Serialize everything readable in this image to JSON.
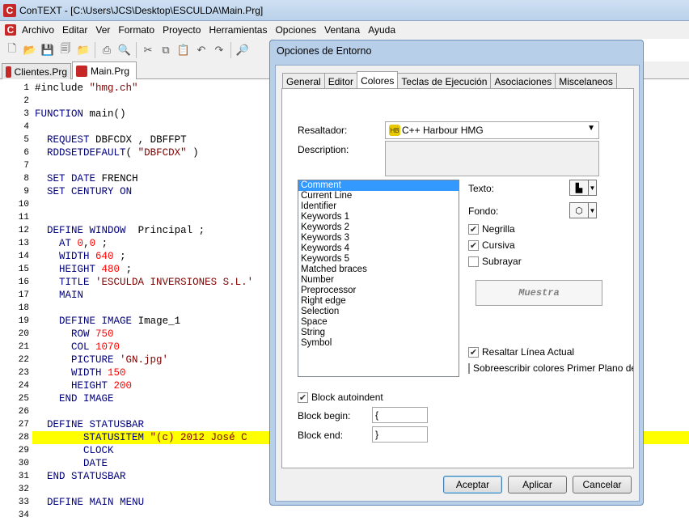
{
  "window": {
    "title": "ConTEXT - [C:\\Users\\JCS\\Desktop\\ESCULDA\\Main.Prg]"
  },
  "menu": [
    "Archivo",
    "Editar",
    "Ver",
    "Formato",
    "Proyecto",
    "Herramientas",
    "Opciones",
    "Ventana",
    "Ayuda"
  ],
  "file_tabs": [
    "Clientes.Prg",
    "Main.Prg"
  ],
  "editor": {
    "lines": [
      {
        "n": "1",
        "code": "#include \"hmg.ch\""
      },
      {
        "n": "2",
        "code": ""
      },
      {
        "n": "3",
        "code": "FUNCTION main()"
      },
      {
        "n": "4",
        "code": ""
      },
      {
        "n": "5",
        "code": "  REQUEST DBFCDX , DBFFPT"
      },
      {
        "n": "6",
        "code": "  RDDSETDEFAULT( \"DBFCDX\" )"
      },
      {
        "n": "7",
        "code": ""
      },
      {
        "n": "8",
        "code": "  SET DATE FRENCH"
      },
      {
        "n": "9",
        "code": "  SET CENTURY ON"
      },
      {
        "n": "10",
        "code": ""
      },
      {
        "n": "11",
        "code": ""
      },
      {
        "n": "12",
        "code": "  DEFINE WINDOW  Principal ;"
      },
      {
        "n": "13",
        "code": "    AT 0,0 ;"
      },
      {
        "n": "14",
        "code": "    WIDTH 640 ;"
      },
      {
        "n": "15",
        "code": "    HEIGHT 480 ;"
      },
      {
        "n": "16",
        "code": "    TITLE 'ESCULDA INVERSIONES S.L.'"
      },
      {
        "n": "17",
        "code": "    MAIN"
      },
      {
        "n": "18",
        "code": ""
      },
      {
        "n": "19",
        "code": "    DEFINE IMAGE Image_1"
      },
      {
        "n": "20",
        "code": "      ROW 750"
      },
      {
        "n": "21",
        "code": "      COL 1070"
      },
      {
        "n": "22",
        "code": "      PICTURE 'GN.jpg'"
      },
      {
        "n": "23",
        "code": "      WIDTH 150"
      },
      {
        "n": "24",
        "code": "      HEIGHT 200"
      },
      {
        "n": "25",
        "code": "    END IMAGE"
      },
      {
        "n": "26",
        "code": ""
      },
      {
        "n": "27",
        "code": "  DEFINE STATUSBAR"
      },
      {
        "n": "28",
        "code": "        STATUSITEM \"(c) 2012 José C"
      },
      {
        "n": "29",
        "code": "        CLOCK"
      },
      {
        "n": "30",
        "code": "        DATE"
      },
      {
        "n": "31",
        "code": "  END STATUSBAR"
      },
      {
        "n": "32",
        "code": ""
      },
      {
        "n": "33",
        "code": "  DEFINE MAIN MENU"
      },
      {
        "n": "34",
        "code": ""
      }
    ],
    "highlight_line": "28"
  },
  "dialog": {
    "title": "Opciones de Entorno",
    "tabs": [
      "General",
      "Editor",
      "Colores",
      "Teclas de Ejecución",
      "Asociaciones",
      "Miscelaneos"
    ],
    "active_tab": "Colores",
    "resaltador_label": "Resaltador:",
    "resaltador_value": "C++ Harbour HMG",
    "description_label": "Description:",
    "elements": [
      "Comment",
      "Current Line",
      "Identifier",
      "Keywords 1",
      "Keywords 2",
      "Keywords 3",
      "Keywords 4",
      "Keywords 5",
      "Matched braces",
      "Number",
      "Preprocessor",
      "Right edge",
      "Selection",
      "Space",
      "String",
      "Symbol"
    ],
    "selected_element": "Comment",
    "texto_label": "Texto:",
    "fondo_label": "Fondo:",
    "negrilla": "Negrilla",
    "cursiva": "Cursiva",
    "subrayar": "Subrayar",
    "muestra": "Muestra",
    "resaltar": "Resaltar Línea Actual",
    "sobrescribir": "Sobreescribir colores Primer Plano de te",
    "block_autoindent": "Block autoindent",
    "block_begin_label": "Block begin:",
    "block_begin_value": "{",
    "block_end_label": "Block end:",
    "block_end_value": "}",
    "ok": "Aceptar",
    "apply": "Aplicar",
    "cancel": "Cancelar"
  },
  "colors": {
    "keyword": "#000080",
    "string": "#800000",
    "number": "#ff0000",
    "highlight": "#ffff00"
  }
}
